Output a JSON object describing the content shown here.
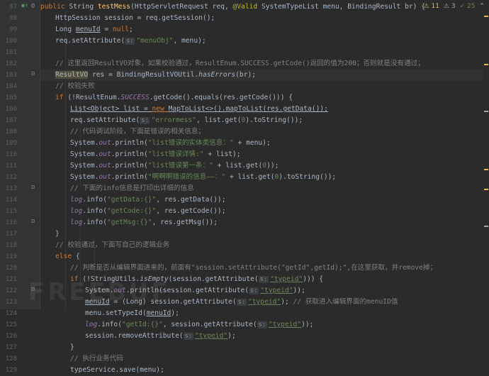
{
  "inspections": {
    "warnings": "11",
    "weak_warnings": "3",
    "ok": "25",
    "expand": "⌃"
  },
  "watermark": "FREEBUF",
  "lines": [
    {
      "n": "97"
    },
    {
      "n": "98"
    },
    {
      "n": "99"
    },
    {
      "n": "100"
    },
    {
      "n": "101"
    },
    {
      "n": "102"
    },
    {
      "n": "103"
    },
    {
      "n": "104"
    },
    {
      "n": "105"
    },
    {
      "n": "106"
    },
    {
      "n": "107"
    },
    {
      "n": "108"
    },
    {
      "n": "109"
    },
    {
      "n": "110"
    },
    {
      "n": "111"
    },
    {
      "n": "112"
    },
    {
      "n": "113"
    },
    {
      "n": "114"
    },
    {
      "n": "115"
    },
    {
      "n": "116"
    },
    {
      "n": "117"
    },
    {
      "n": "118"
    },
    {
      "n": "119"
    },
    {
      "n": "120"
    },
    {
      "n": "121"
    },
    {
      "n": "122"
    },
    {
      "n": "123"
    },
    {
      "n": "124"
    },
    {
      "n": "125"
    },
    {
      "n": "126"
    },
    {
      "n": "127"
    },
    {
      "n": "128"
    },
    {
      "n": "129"
    }
  ],
  "code": {
    "l97": {
      "kw1": "public ",
      "t1": "String ",
      "fn": "testMess",
      "t2": "(HttpServletRequest req, ",
      "ann": "@Valid ",
      "t3": "SystemTypeList menu, BindingResult br) {"
    },
    "l98": {
      "t1": "HttpSession session = req.getSession();"
    },
    "l99": {
      "t1": "Long ",
      "var": "menuId",
      "t2": " = ",
      "kw": "null",
      "t3": ";"
    },
    "l100": {
      "t1": "req.setAttribute(",
      "hint": "s:",
      "str": "\"menuObj\"",
      "t2": ", menu);"
    },
    "l102": {
      "cm": "// 这里返回ResultVO对象，如果校验通过，ResultEnum.SUCCESS.getCode()返回的值为200；否则就是没有通过；"
    },
    "l103": {
      "cls": "ResultVO",
      "t1": " res = BindingResultVOUtil.",
      "it": "hasErrors",
      "t2": "(br);"
    },
    "l104": {
      "cm": "// 校验失败"
    },
    "l105": {
      "kw": "if ",
      "t1": "(!ResultEnum.",
      "fld": "SUCCESS",
      "t2": ".getCode().equals(res.getCode())) {"
    },
    "l106": {
      "a": "List<Object> list = ",
      "kw": "new ",
      "b": "MapToList<>().mapToList(res.getData());"
    },
    "l107": {
      "t1": "req.setAttribute(",
      "hint": "s:",
      "str": "\"errormess\"",
      "t2": ", list.get(",
      "num": "0",
      "t3": ").toString());"
    },
    "l108": {
      "cm": "// 代码调试阶段，下面是错误的相关信息；"
    },
    "l109": {
      "t1": "System.",
      "fld": "out",
      "t2": ".println(",
      "str": "\"list错误的实体类信息：\"",
      "t3": " + menu);"
    },
    "l110": {
      "t1": "System.",
      "fld": "out",
      "t2": ".println(",
      "str": "\"list错误详情:\"",
      "t3": " + list);"
    },
    "l111": {
      "t1": "System.",
      "fld": "out",
      "t2": ".println(",
      "str": "\"list错误第一条：\"",
      "t3": " + list.get(",
      "num": "0",
      "t4": "));"
    },
    "l112": {
      "t1": "System.",
      "fld": "out",
      "t2": ".println(",
      "str": "\"啊啊啊错误的信息——：\"",
      "t3": " + list.get(",
      "num": "0",
      "t4": ").toString());"
    },
    "l113": {
      "cm": "// 下面的info信息是打印出详细的信息"
    },
    "l114": {
      "fld": "log",
      "t1": ".info(",
      "str": "\"getData:{}\"",
      "t2": ", res.getData());"
    },
    "l115": {
      "fld": "log",
      "t1": ".info(",
      "str": "\"getCode:{}\"",
      "t2": ", res.getCode());"
    },
    "l116": {
      "fld": "log",
      "t1": ".info(",
      "str": "\"getMsg:{}\"",
      "t2": ", res.getMsg());"
    },
    "l117": {
      "t1": "}"
    },
    "l118": {
      "cm": "// 校验通过，下面写自己的逻辑业务"
    },
    "l119": {
      "kw": "else ",
      "t1": "{"
    },
    "l120": {
      "cm": "// 判断是否从编辑界面进来的，前面有\"session.setAttribute(\"getId\",getId);\",在这里获取，并remove掉；"
    },
    "l121": {
      "kw": "if ",
      "t1": "(!StringUtils.",
      "it": "isEmpty",
      "t2": "(session.getAttribute(",
      "hint": "s:",
      "str": "\"typeid\"",
      "t3": "))) {"
    },
    "l122": {
      "t1": "System.",
      "fld": "out",
      "t2": ".println(session.getAttribute(",
      "hint": "s:",
      "str": "\"typeid\"",
      "t3": "));"
    },
    "l123": {
      "var": "menuId",
      "t1": " = (Long) session.getAttribute(",
      "hint": "s:",
      "str": "\"typeid\"",
      "t2": "); ",
      "cm": "// 获取进入编辑界面的menuID值"
    },
    "l124": {
      "t1": "menu.setTypeId(",
      "var": "menuId",
      "t2": ");"
    },
    "l125": {
      "fld": "log",
      "t1": ".info(",
      "str": "\"getId:{}\"",
      "t2": ", session.getAttribute(",
      "hint": "s:",
      "str2": "\"typeid\"",
      "t3": "));"
    },
    "l126": {
      "t1": "session.removeAttribute(",
      "hint": "s:",
      "str": "\"typeid\"",
      "t2": ");"
    },
    "l127": {
      "t1": "}"
    },
    "l128": {
      "cm": "// 执行业务代码"
    },
    "l129": {
      "t1": "typeService.save(menu);"
    }
  },
  "colors": {
    "keyword": "#cc7832",
    "string": "#6a8759",
    "comment": "#808080",
    "field": "#9876aa",
    "method": "#ffc66d",
    "annotation": "#bbb529",
    "warning": "#e8b84a",
    "ok": "#6a8759"
  }
}
